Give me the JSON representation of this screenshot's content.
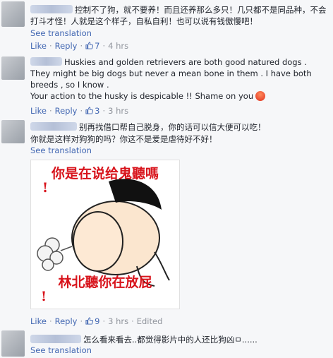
{
  "comments": [
    {
      "text": "控制不了狗，就不要养！而且还养那么多只！几只都不是同品种，不会打斗才怪！人就是这个样子，自私自利！也可以说有钱傲慢吧！",
      "see_translation": "See translation",
      "like": "Like",
      "reply": "Reply",
      "likes": "7",
      "time": "4 hrs"
    },
    {
      "text": "Huskies and golden retrievers are both good natured dogs . They might be big dogs but never a mean bone in them . I have both breeds , so I know .",
      "text2": "Your action to the husky is despicable !! Shame on you",
      "like": "Like",
      "reply": "Reply",
      "likes": "3",
      "time": "3 hrs"
    },
    {
      "text": "别再找借口帮自己脱身，你的话可以信大便可以吃！",
      "text2": "你就是这样对狗狗的吗？你这不是爱是虐待好不好！",
      "see_translation": "See translation",
      "sticker_top": "你是在说给鬼聽嗎",
      "sticker_bottom": "林北聽你在放屁",
      "like": "Like",
      "reply": "Reply",
      "likes": "9",
      "time": "3 hrs",
      "edited": "Edited"
    },
    {
      "text": "怎么看来看去..都觉得影片中的人还比狗凶ㅁ......",
      "see_translation": "See translation"
    }
  ],
  "colors": {
    "link": "#4267b2",
    "meta": "#90949c",
    "sticker_text": "#d8141c"
  }
}
